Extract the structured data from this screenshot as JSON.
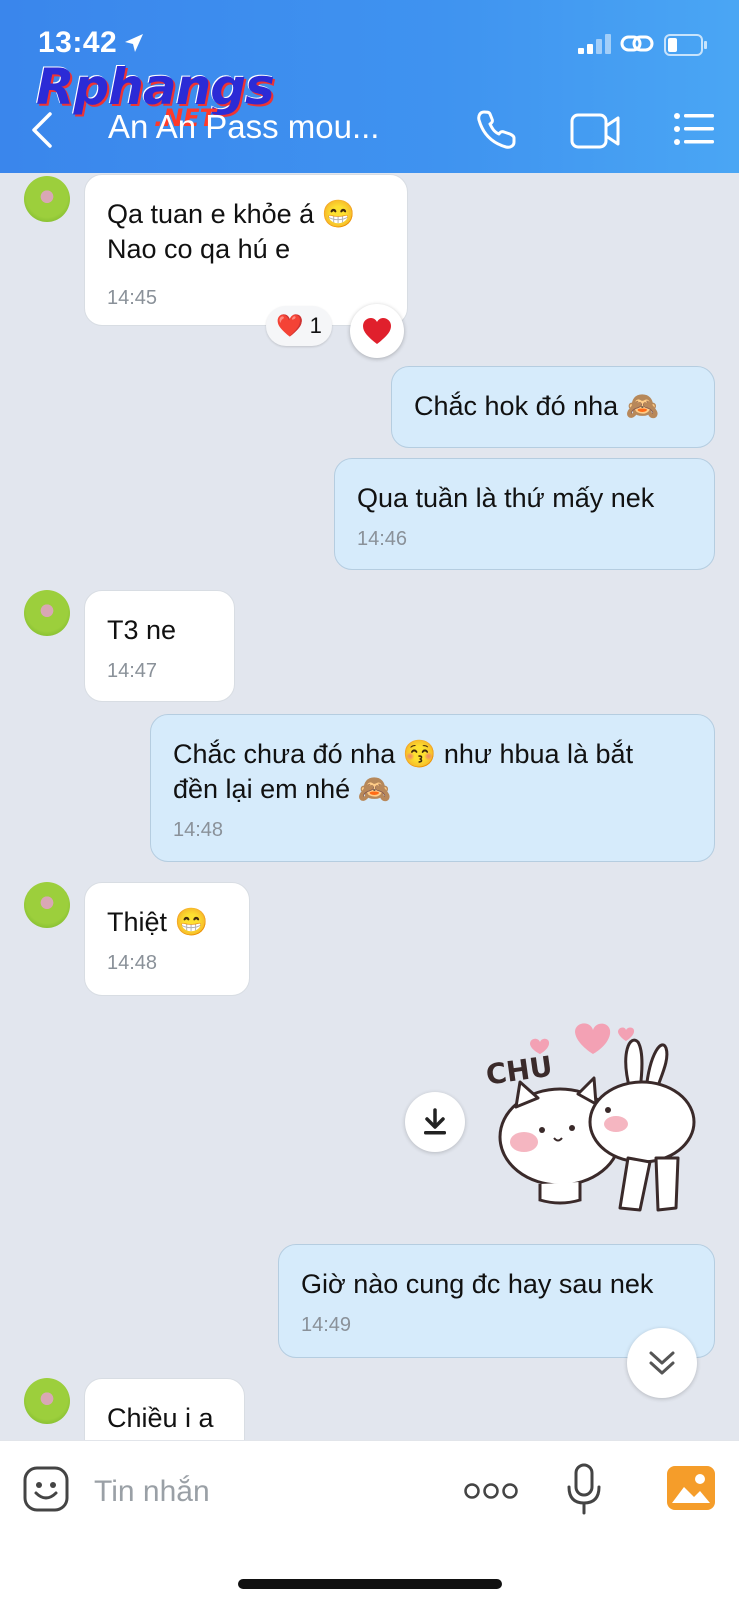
{
  "status_bar": {
    "time": "13:42"
  },
  "watermark": {
    "main": "Rphangs",
    "sub": ".NET"
  },
  "header": {
    "title": "An An Pass mou..."
  },
  "messages": [
    {
      "side": "in",
      "lines": [
        "Qa tuan e khỏe á 😁",
        "Nao co qa hú e"
      ],
      "time": "14:45"
    },
    {
      "side": "out",
      "lines": [
        "Chắc hok đó nha 🙈"
      ],
      "time": ""
    },
    {
      "side": "out",
      "lines": [
        "Qua tuần là thứ mấy  nek"
      ],
      "time": "14:46"
    },
    {
      "side": "in",
      "lines": [
        "T3 ne"
      ],
      "time": "14:47"
    },
    {
      "side": "out",
      "lines": [
        "Chắc chưa đó nha 😚 như hbua là bắt",
        "đền lại em nhé 🙈"
      ],
      "time": "14:48"
    },
    {
      "side": "in",
      "lines": [
        "Thiệt 😁"
      ],
      "time": "14:48"
    },
    {
      "side": "out",
      "lines": [
        "Giờ nào cung đc hay sau nek"
      ],
      "time": "14:49"
    },
    {
      "side": "in",
      "lines": [
        "Chiều i a"
      ],
      "time": ""
    }
  ],
  "reaction": {
    "emoji": "❤️",
    "count": "1"
  },
  "sticker": {
    "text": "CHU"
  },
  "input": {
    "placeholder": "Tin nhắn"
  },
  "colors": {
    "header": "#3f93f0",
    "outgoing_bubble": "#d6ebfb",
    "incoming_bubble": "#ffffff",
    "background": "#e2e6ee"
  }
}
